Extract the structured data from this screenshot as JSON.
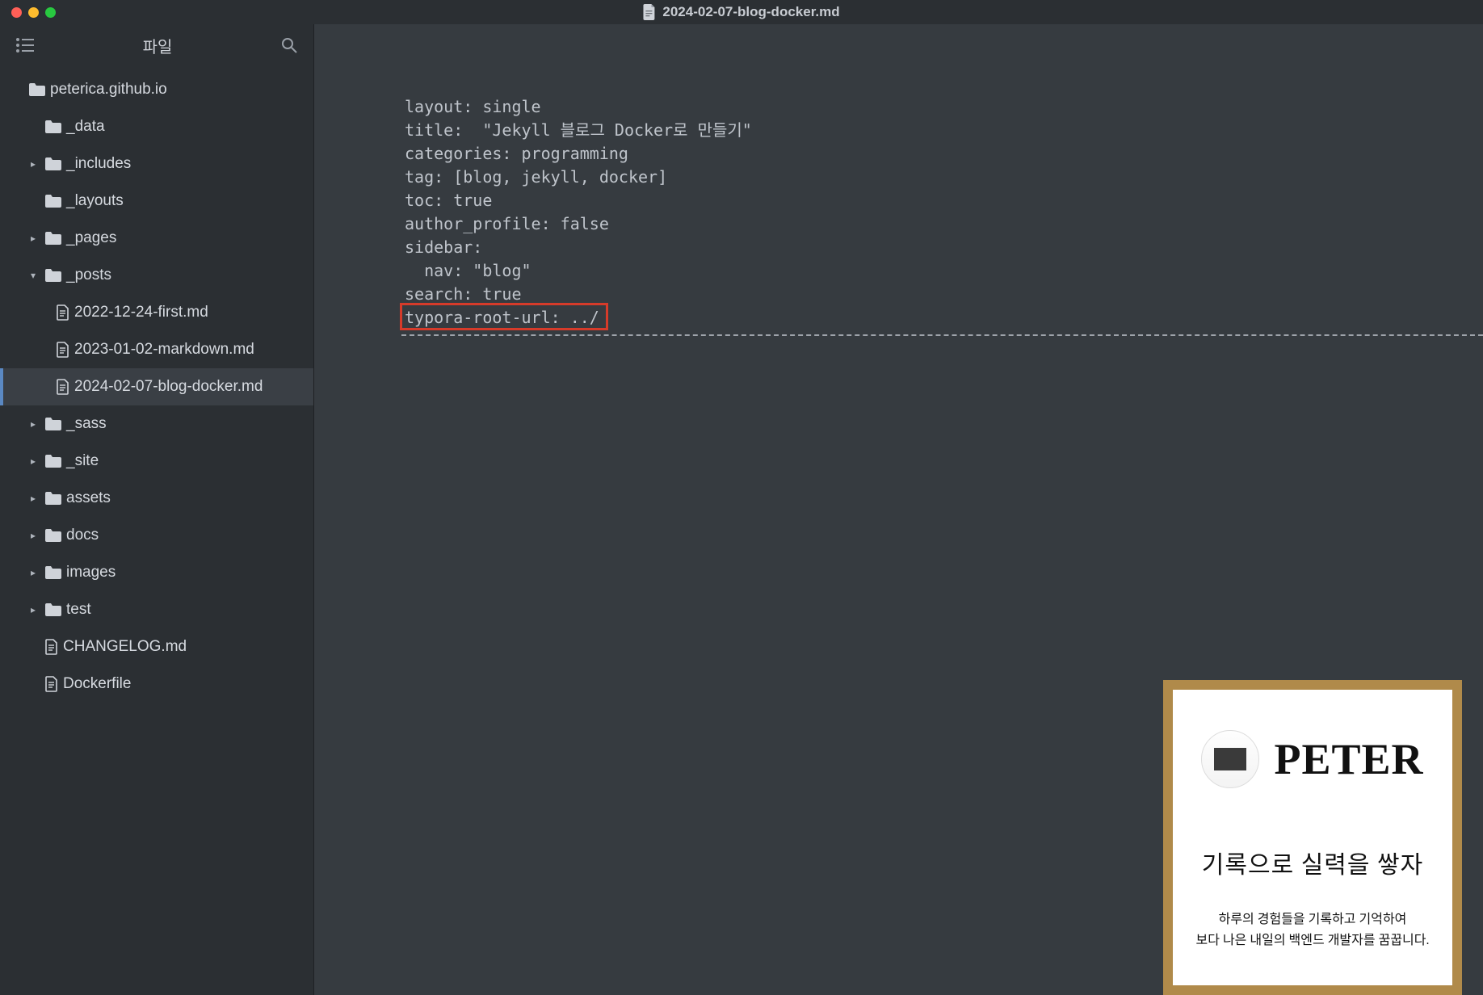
{
  "titlebar": {
    "filename": "2024-02-07-blog-docker.md"
  },
  "sidebar": {
    "top_label": "파일",
    "root": "peterica.github.io",
    "items": [
      {
        "name": "_data",
        "type": "folder",
        "expandable": false
      },
      {
        "name": "_includes",
        "type": "folder",
        "expandable": true
      },
      {
        "name": "_layouts",
        "type": "folder",
        "expandable": false
      },
      {
        "name": "_pages",
        "type": "folder",
        "expandable": true
      },
      {
        "name": "_posts",
        "type": "folder",
        "expandable": true,
        "expanded": true,
        "children": [
          {
            "name": "2022-12-24-first.md",
            "type": "file"
          },
          {
            "name": "2023-01-02-markdown.md",
            "type": "file"
          },
          {
            "name": "2024-02-07-blog-docker.md",
            "type": "file",
            "selected": true
          }
        ]
      },
      {
        "name": "_sass",
        "type": "folder",
        "expandable": true
      },
      {
        "name": "_site",
        "type": "folder",
        "expandable": true
      },
      {
        "name": "assets",
        "type": "folder",
        "expandable": true
      },
      {
        "name": "docs",
        "type": "folder",
        "expandable": true
      },
      {
        "name": "images",
        "type": "folder",
        "expandable": true
      },
      {
        "name": "test",
        "type": "folder",
        "expandable": true
      },
      {
        "name": "CHANGELOG.md",
        "type": "file"
      },
      {
        "name": "Dockerfile",
        "type": "file"
      }
    ]
  },
  "frontmatter": {
    "l0": "layout: single",
    "l1": "title:  \"Jekyll 블로그 Docker로 만들기\"",
    "l2": "categories: programming",
    "l3": "tag: [blog, jekyll, docker]",
    "l4": "toc: true",
    "l5": "author_profile: false",
    "l6": "sidebar:",
    "l7": "  nav: \"blog\"",
    "l8": "search: true",
    "l9": "typora-root-url: ../"
  },
  "card": {
    "name": "PETER",
    "tagline": "기록으로 실력을 쌓자",
    "sub1": "하루의 경험들을 기록하고 기억하여",
    "sub2": "보다 나은 내일의 백엔드 개발자를 꿈꿉니다."
  }
}
